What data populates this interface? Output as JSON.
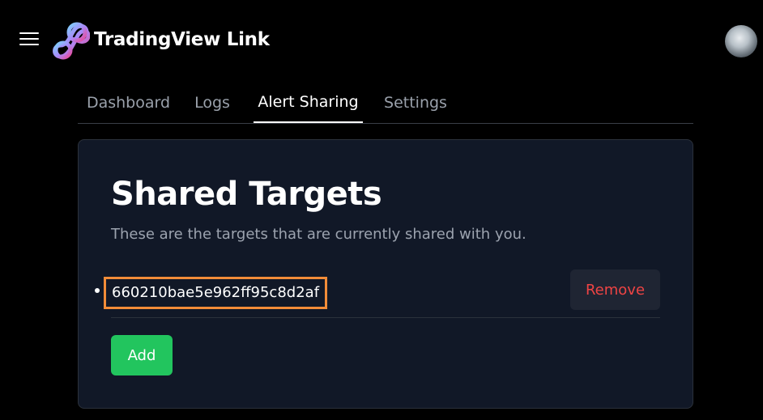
{
  "app": {
    "title": "TradingView Link"
  },
  "header": {
    "menu_icon": "hamburger-menu-icon",
    "logo_icon": "infinity-logo-icon",
    "avatar_icon": "user-avatar"
  },
  "nav": {
    "tabs": [
      {
        "label": "Dashboard",
        "active": false
      },
      {
        "label": "Logs",
        "active": false
      },
      {
        "label": "Alert Sharing",
        "active": true
      },
      {
        "label": "Settings",
        "active": false
      }
    ]
  },
  "main": {
    "title": "Shared Targets",
    "subtitle": "These are the targets that are currently shared with you.",
    "targets": [
      {
        "id": "660210bae5e962ff95c8d2af",
        "remove_label": "Remove"
      }
    ],
    "add_label": "Add"
  },
  "colors": {
    "background": "#000000",
    "card": "#111827",
    "accent_green": "#22c55e",
    "danger_red": "#ef4444",
    "highlight_orange": "#f28c38",
    "muted_text": "#9ca3af"
  }
}
